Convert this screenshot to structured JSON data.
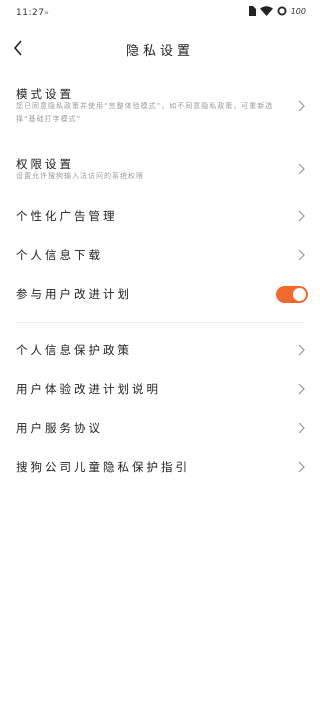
{
  "status_bar": {
    "time": "11:27",
    "notification": "»",
    "battery": "100"
  },
  "header": {
    "title": "隐私设置"
  },
  "settings": {
    "mode": {
      "title": "模式设置",
      "desc": "您已同意隐私政策并使用“完整体验模式”，如不同意隐私政策，可重新选择“基础打字模式”"
    },
    "permissions": {
      "title": "权限设置",
      "desc": "设置允许搜狗输入法访问的系统权限"
    },
    "ads": {
      "title": "个性化广告管理"
    },
    "download": {
      "title": "个人信息下载"
    },
    "improvement": {
      "title": "参与用户改进计划",
      "enabled": true
    }
  },
  "links": {
    "privacy_policy": "个人信息保护政策",
    "experience_plan": "用户体验改进计划说明",
    "service_agreement": "用户服务协议",
    "child_policy": "搜狗公司儿童隐私保护指引"
  }
}
